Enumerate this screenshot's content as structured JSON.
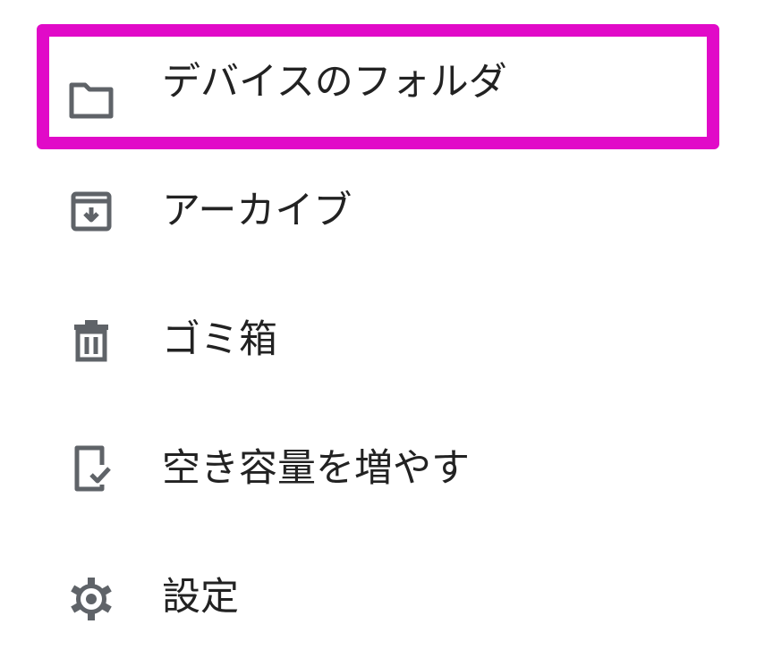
{
  "menu": {
    "items": [
      {
        "label": "デバイスのフォルダ",
        "icon": "folder-icon",
        "highlighted": true
      },
      {
        "label": "アーカイブ",
        "icon": "archive-icon",
        "highlighted": false
      },
      {
        "label": "ゴミ箱",
        "icon": "trash-icon",
        "highlighted": false
      },
      {
        "label": "空き容量を増やす",
        "icon": "phone-check-icon",
        "highlighted": false
      },
      {
        "label": "設定",
        "icon": "gear-icon",
        "highlighted": false
      }
    ]
  },
  "colors": {
    "highlight_border": "#e10ac8",
    "icon": "#5f6368",
    "text": "#222222",
    "background": "#ffffff"
  }
}
